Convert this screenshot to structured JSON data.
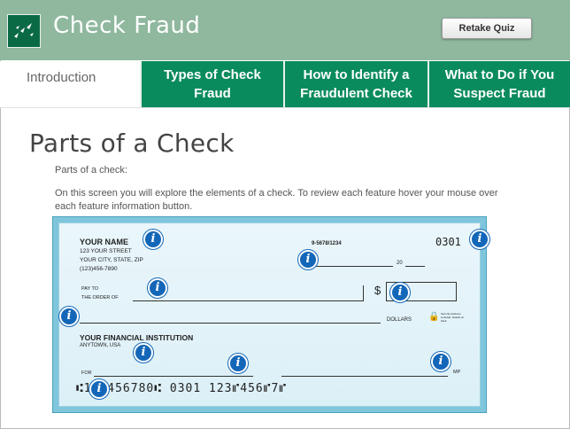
{
  "header": {
    "title": "Check Fraud",
    "retake_label": "Retake Quiz",
    "logo_icon": "bank-logo-icon"
  },
  "tabs": [
    {
      "label": "Introduction"
    },
    {
      "label": "Types of Check Fraud"
    },
    {
      "label": "How to Identify a Fraudulent Check"
    },
    {
      "label": "What to Do if You Suspect Fraud"
    }
  ],
  "main": {
    "heading": "Parts of a Check",
    "subheading": "Parts of a check:",
    "description": "On this screen you will explore the elements of a check. To review each feature hover your mouse over each feature information button."
  },
  "check": {
    "name": "YOUR NAME",
    "street": "123 YOUR STREET",
    "city": "YOUR CITY, STATE, ZIP",
    "phone": "(123)456-7890",
    "routing_fraction": "9-5678/1234",
    "check_number": "0301",
    "date_label": "20",
    "pay_to_line1": "PAY TO",
    "pay_to_line2": "THE ORDER OF",
    "dollar_sign": "$",
    "dollars_label": "DOLLARS",
    "security_note": "Security features included. Details on back.",
    "bank_name": "YOUR FINANCIAL INSTITUTION",
    "bank_city": "ANYTOWN, USA",
    "for_label": "FOR",
    "signature_label": "MP",
    "micr_line": "⑆123456780⑆ 0301 123⑈456⑈7⑈",
    "info_icon_label": "i"
  },
  "colors": {
    "header_bg": "#8fb89e",
    "tab_green": "#0a8b5e",
    "info_blue": "#1467b8",
    "check_border": "#7fc6dd"
  }
}
